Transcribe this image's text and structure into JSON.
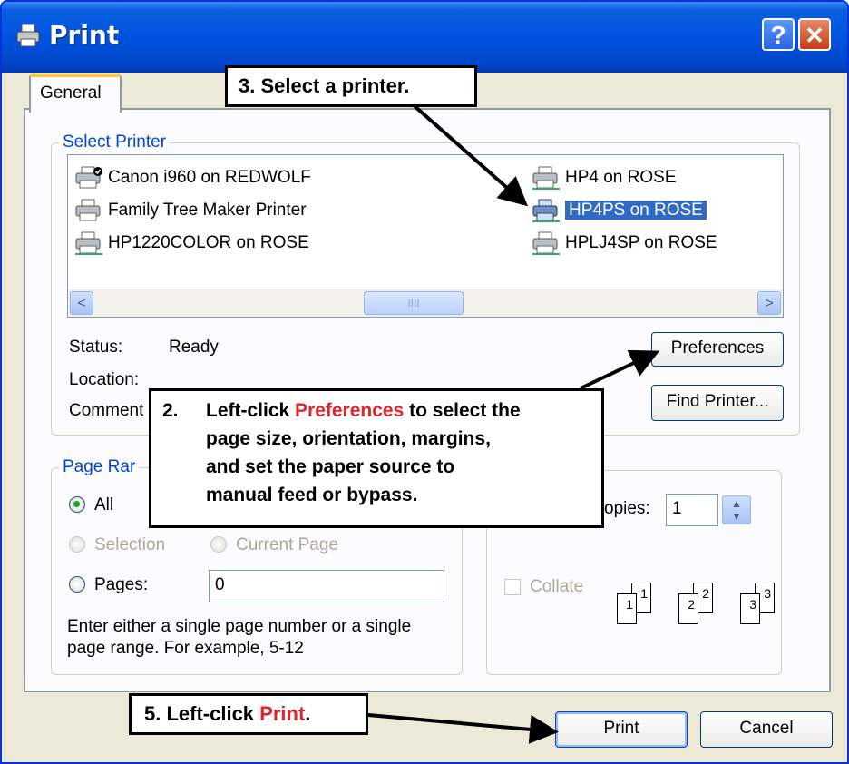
{
  "window": {
    "title": "Print",
    "help_label": "?",
    "close_label": "✕"
  },
  "tabs": [
    {
      "label": "General"
    }
  ],
  "select_printer": {
    "legend": "Select Printer",
    "printers": [
      {
        "name": "Canon i960 on REDWOLF",
        "selected": false
      },
      {
        "name": "Family Tree Maker Printer",
        "selected": false
      },
      {
        "name": "HP1220COLOR on ROSE",
        "selected": false
      },
      {
        "name": "HP4 on ROSE",
        "selected": false
      },
      {
        "name": "HP4PS on ROSE",
        "selected": true
      },
      {
        "name": "HPLJ4SP on ROSE",
        "selected": false
      }
    ],
    "scroll_left": "<",
    "scroll_right": ">",
    "scroll_thumb_grip": "IIII",
    "status_label": "Status:",
    "status_value": "Ready",
    "location_label": "Location:",
    "comment_label": "Comment",
    "preferences_button": "Preferences",
    "find_printer_button": "Find Printer..."
  },
  "page_range": {
    "legend": "Page Rar",
    "all_label": "All",
    "selection_label": "Selection",
    "current_page_label": "Current Page",
    "pages_label": "Pages:",
    "pages_value": "0",
    "help_line1": "Enter either a single page number or a single",
    "help_line2": "page range.  For example, 5-12"
  },
  "copies": {
    "copies_label": "opies:",
    "copies_value": "1",
    "collate_label": "Collate",
    "spin_up": "▲",
    "spin_down": "▼",
    "stack1": [
      "1",
      "1"
    ],
    "stack2": [
      "2",
      "2"
    ],
    "stack3": [
      "3",
      "3"
    ]
  },
  "buttons": {
    "print": "Print",
    "cancel": "Cancel"
  },
  "callouts": {
    "step3": "3.   Select a printer.",
    "step2_num": "2.",
    "step2_pre": "Left-click ",
    "step2_highlight": "Preferences",
    "step2_post": " to select the",
    "step2_line2": "page size, orientation, margins,",
    "step2_line3": "and set the paper source to",
    "step2_line4": "manual feed or bypass.",
    "step5_pre": "5.   Left-click ",
    "step5_highlight": "Print",
    "step5_post": "."
  },
  "colors": {
    "title_bar": "#0053e0",
    "legend_text": "#0046d5",
    "selection": "#316ac5",
    "callout_highlight": "#e0262a"
  },
  "icons": [
    "printer-icon",
    "help-icon",
    "close-icon",
    "scroll-left-icon",
    "scroll-right-icon",
    "spin-up-icon",
    "spin-down-icon"
  ]
}
